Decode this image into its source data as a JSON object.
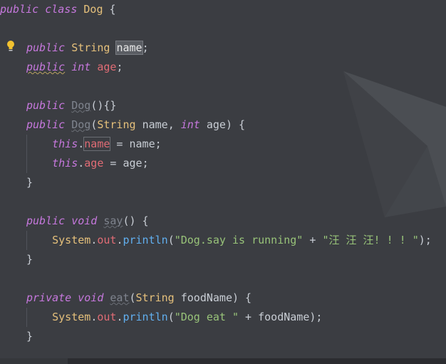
{
  "editor": {
    "language": "java",
    "theme_colors": {
      "background": "#3b3d42",
      "keyword": "#c678dd",
      "type": "#e5c07b",
      "field": "#e06c75",
      "string": "#98c379",
      "method": "#61afef",
      "text": "#c8cdd4"
    },
    "gutter_icon": "lightbulb-icon",
    "tokens": {
      "public": "public",
      "class": "class",
      "private": "private",
      "void": "void",
      "int": "int",
      "this": "this",
      "String": "String",
      "Dog": "Dog",
      "System": "System",
      "out": "out",
      "println": "println",
      "name": "name",
      "age": "age",
      "say": "say",
      "eat": "eat",
      "foodName": "foodName"
    },
    "strings": {
      "say_msg": "\"Dog.say is running\"",
      "bark": "\"汪 汪 汪! ! ! \"",
      "eat_msg": "\"Dog eat \""
    }
  }
}
